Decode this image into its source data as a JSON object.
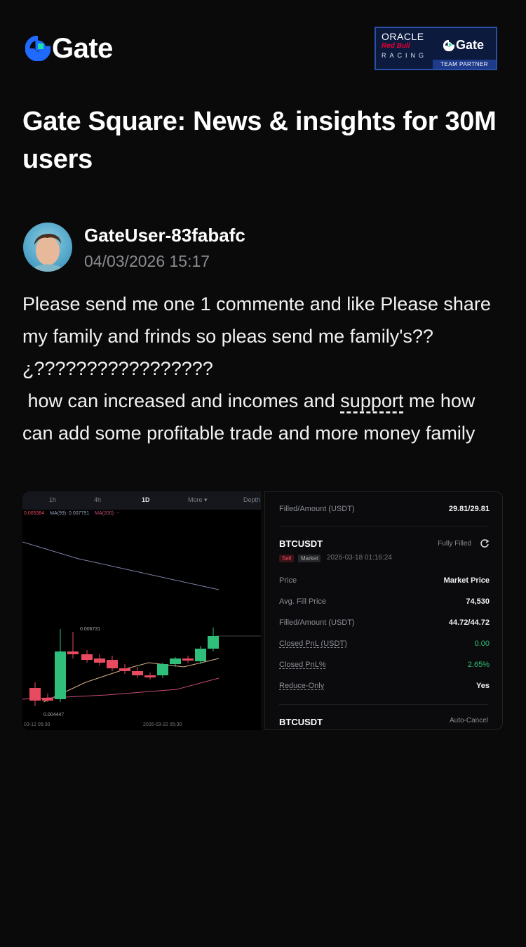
{
  "header": {
    "logo_text": "Gate",
    "partner_badge": {
      "oracle": "ORACLE",
      "redbull": "Red Bull",
      "racing": "RACING",
      "gate": "Gate",
      "team_partner": "TEAM PARTNER"
    }
  },
  "headline": "Gate Square: News & insights for 30M users",
  "post": {
    "username": "GateUser-83fabafc",
    "datetime": "04/03/2026 15:17",
    "text_line1": "Please send me one 1 commente and like Please share my family and frinds so pleas send me family's??¿?????????????????\n how can increased and incomes and ",
    "text_link": "support",
    "text_line2": " me how can add some profitable trade and more money family"
  },
  "chart_image": {
    "timeframes": [
      "1h",
      "4h",
      "1D",
      "More ▾",
      "Depth"
    ],
    "active_timeframe": "1D",
    "ma_labels": [
      "0.005384",
      "MA(99): 0.007791",
      "MA(200): --"
    ],
    "high_label": "0.006731",
    "low_label": "0.004447",
    "x_labels": [
      "03-12 05:30",
      "2026-03-22 05:30"
    ],
    "colors": {
      "up": "#2fbf7a",
      "down": "#e84a5f",
      "ma_slow": "#9aa0c0",
      "ma_fast": "#d6b28a",
      "ma_long": "#c44a7a"
    }
  },
  "order_image": {
    "top_row": {
      "label": "Filled/Amount (USDT)",
      "value": "29.81/29.81"
    },
    "symbol": "BTCUSDT",
    "status": "Fully Filled",
    "tag_side": "Sell",
    "tag_type": "Market",
    "order_time": "2026-03-18 01:16:24",
    "rows": [
      {
        "label": "Price",
        "value": "Market Price"
      },
      {
        "label": "Avg. Fill Price",
        "value": "74,530"
      },
      {
        "label": "Filled/Amount (USDT)",
        "value": "44.72/44.72"
      },
      {
        "label": "Closed PnL (USDT)",
        "value": "0.00"
      },
      {
        "label": "Closed PnL%",
        "value": "2.65%"
      },
      {
        "label": "Reduce-Only",
        "value": "Yes"
      }
    ],
    "bottom_symbol": "BTCUSDT",
    "bottom_status": "Auto-Cancel"
  }
}
